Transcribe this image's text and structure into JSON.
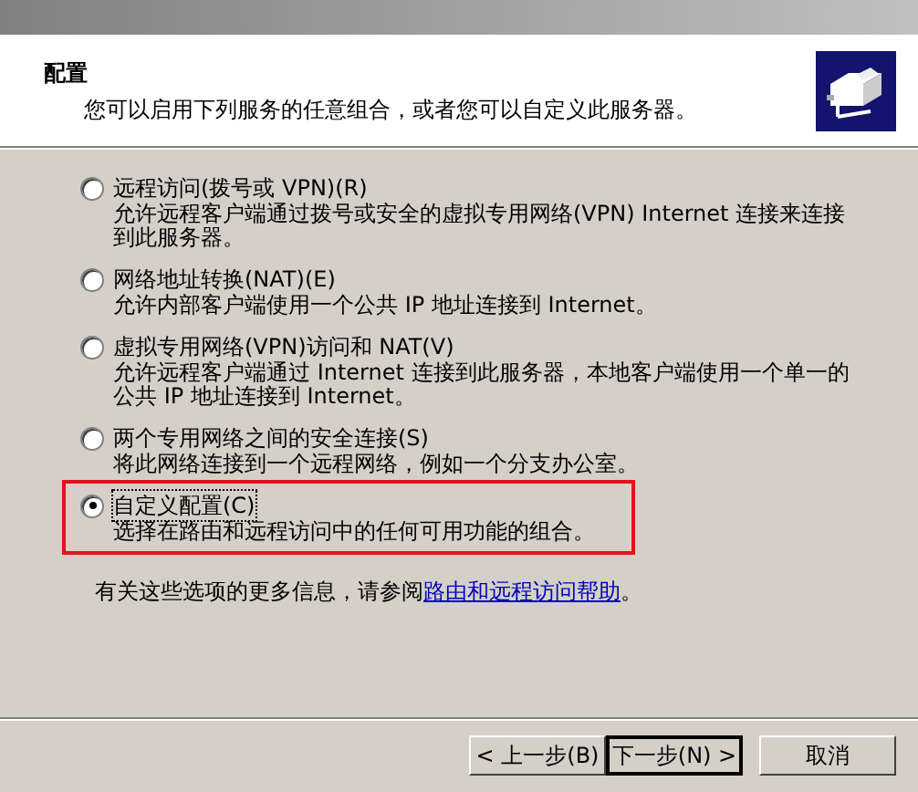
{
  "header": {
    "title": "配置",
    "subtitle": "您可以启用下列服务的任意组合，或者您可以自定义此服务器。"
  },
  "options": [
    {
      "label": "远程访问(拨号或 VPN)(R)",
      "description": "允许远程客户端通过拨号或安全的虚拟专用网络(VPN) Internet 连接来连接到此服务器。",
      "selected": false,
      "highlighted": false
    },
    {
      "label": "网络地址转换(NAT)(E)",
      "description": "允许内部客户端使用一个公共 IP 地址连接到 Internet。",
      "selected": false,
      "highlighted": false
    },
    {
      "label": "虚拟专用网络(VPN)访问和 NAT(V)",
      "description": "允许远程客户端通过 Internet 连接到此服务器，本地客户端使用一个单一的公共 IP 地址连接到 Internet。",
      "selected": false,
      "highlighted": false
    },
    {
      "label": "两个专用网络之间的安全连接(S)",
      "description": "将此网络连接到一个远程网络，例如一个分支办公室。",
      "selected": false,
      "highlighted": false
    },
    {
      "label": "自定义配置(C)",
      "description": "选择在路由和远程访问中的任何可用功能的组合。",
      "selected": true,
      "highlighted": true
    }
  ],
  "help": {
    "text": "有关这些选项的更多信息，请参阅",
    "link": "路由和远程访问帮助",
    "end": "。"
  },
  "buttons": [
    {
      "label": "< 上一步(B)",
      "default": false
    },
    {
      "label": "下一步(N) >",
      "default": true
    },
    {
      "label": "取消",
      "default": false
    }
  ]
}
